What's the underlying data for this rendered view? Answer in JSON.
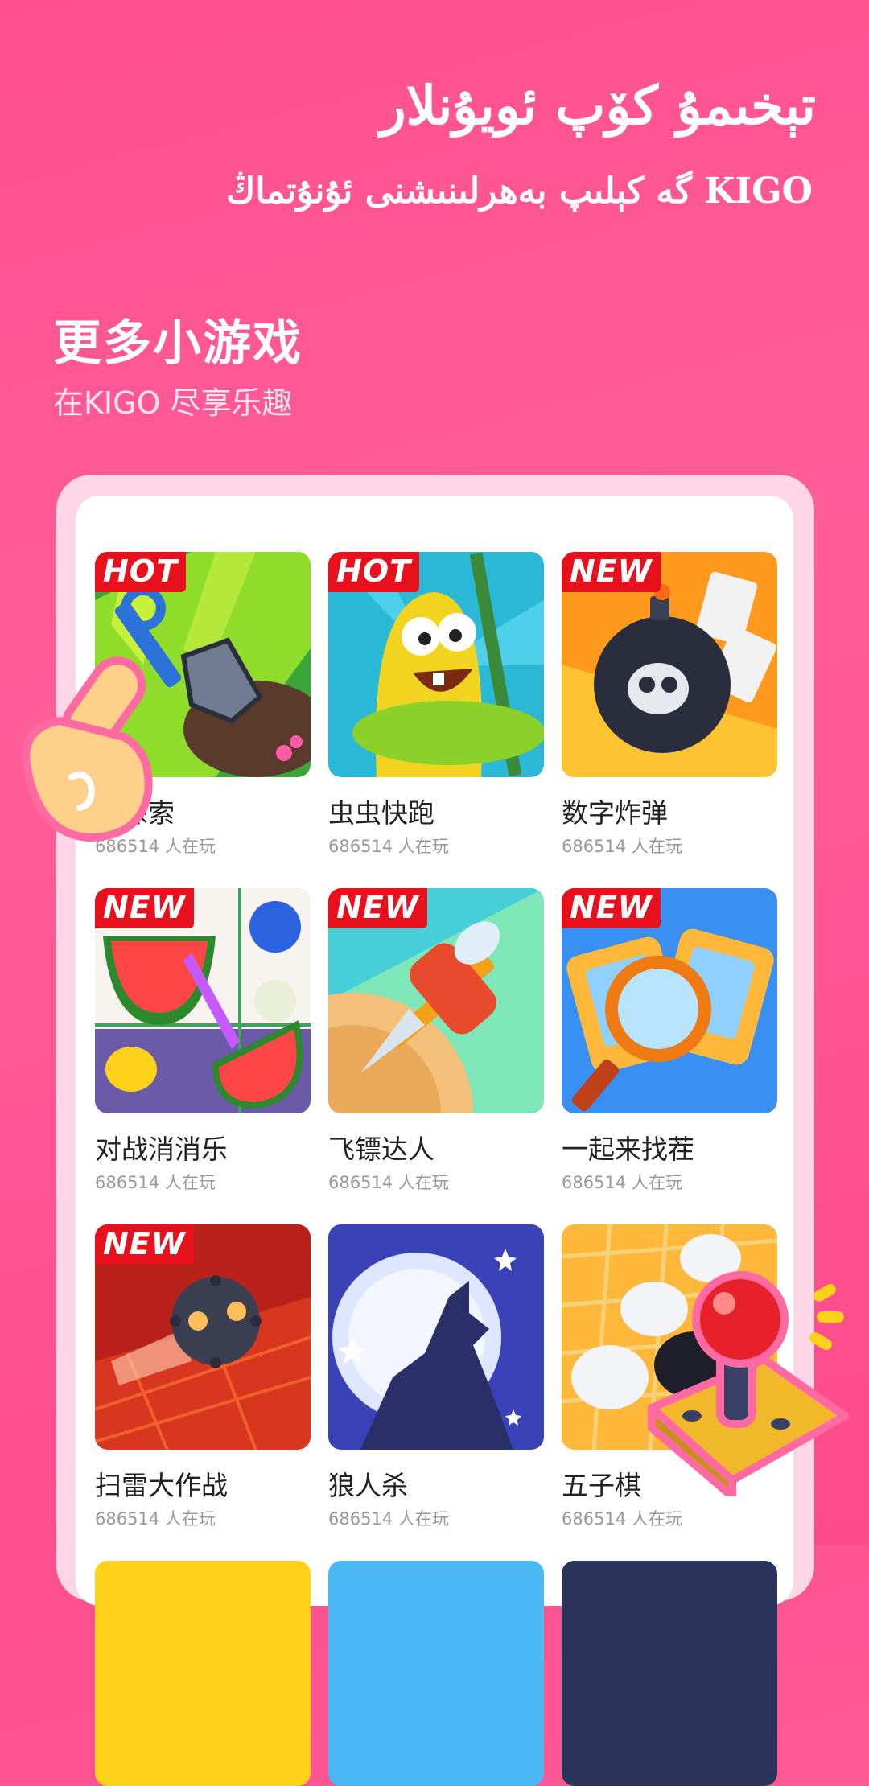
{
  "header": {
    "ug_title": "تېخىمۇ كۆپ ئويۇنلار",
    "ug_subtitle": "KIGO گە كېلىپ بەھرلىنىشنى ئۇنۇتماڭ",
    "cn_title": "更多小游戏",
    "cn_subtitle": "在KIGO 尽享乐趣"
  },
  "colors": {
    "background": "#ff5a94",
    "badge": "#e8101c",
    "panel": "#ffd6e6"
  },
  "games": [
    {
      "name": "…探索",
      "players": "686514 人在玩",
      "badge": "HOT",
      "icon": "shovel-icon"
    },
    {
      "name": "虫虫快跑",
      "players": "686514 人在玩",
      "badge": "HOT",
      "icon": "worm-icon"
    },
    {
      "name": "数字炸弹",
      "players": "686514 人在玩",
      "badge": "NEW",
      "icon": "bomb-icon"
    },
    {
      "name": "对战消消乐",
      "players": "686514 人在玩",
      "badge": "NEW",
      "icon": "fruit-icon"
    },
    {
      "name": "飞镖达人",
      "players": "686514 人在玩",
      "badge": "NEW",
      "icon": "dart-icon"
    },
    {
      "name": "一起来找茬",
      "players": "686514 人在玩",
      "badge": "NEW",
      "icon": "magnifier-icon"
    },
    {
      "name": "扫雷大作战",
      "players": "686514 人在玩",
      "badge": "NEW",
      "icon": "mine-icon"
    },
    {
      "name": "狼人杀",
      "players": "686514 人在玩",
      "badge": "",
      "icon": "wolf-icon"
    },
    {
      "name": "五子棋",
      "players": "686514 人在玩",
      "badge": "",
      "icon": "gomoku-icon"
    }
  ]
}
